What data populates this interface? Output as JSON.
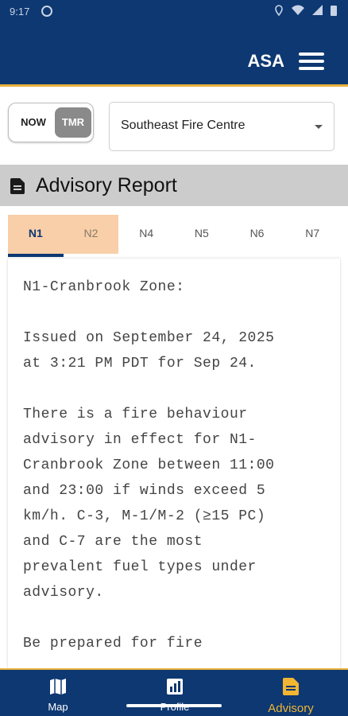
{
  "status_bar": {
    "time": "9:17"
  },
  "app_bar": {
    "title": "ASA"
  },
  "toggle": {
    "now_label": "NOW",
    "tmr_label": "TMR"
  },
  "region": {
    "selected": "Southeast Fire Centre"
  },
  "section": {
    "title": "Advisory Report"
  },
  "tabs": [
    {
      "label": "N1"
    },
    {
      "label": "N2"
    },
    {
      "label": "N4"
    },
    {
      "label": "N5"
    },
    {
      "label": "N6"
    },
    {
      "label": "N7"
    }
  ],
  "report": {
    "text": "N1-Cranbrook Zone:\n\nIssued on September 24, 2025\nat 3:21 PM PDT for Sep 24.\n\nThere is a fire behaviour\nadvisory in effect for N1-\nCranbrook Zone between 11:00\nand 23:00 if winds exceed 5\nkm/h. C-3, M-1/M-2 (≥15 PC)\nand C-7 are the most\nprevalent fuel types under\nadvisory.\n\nBe prepared for fire"
  },
  "bottom_nav": {
    "map_label": "Map",
    "profile_label": "Profile",
    "advisory_label": "Advisory"
  },
  "colors": {
    "primary": "#0d3872",
    "accent": "#e8b23c",
    "tab_highlight": "#f8cfa8",
    "active_nav": "#f2b632"
  }
}
